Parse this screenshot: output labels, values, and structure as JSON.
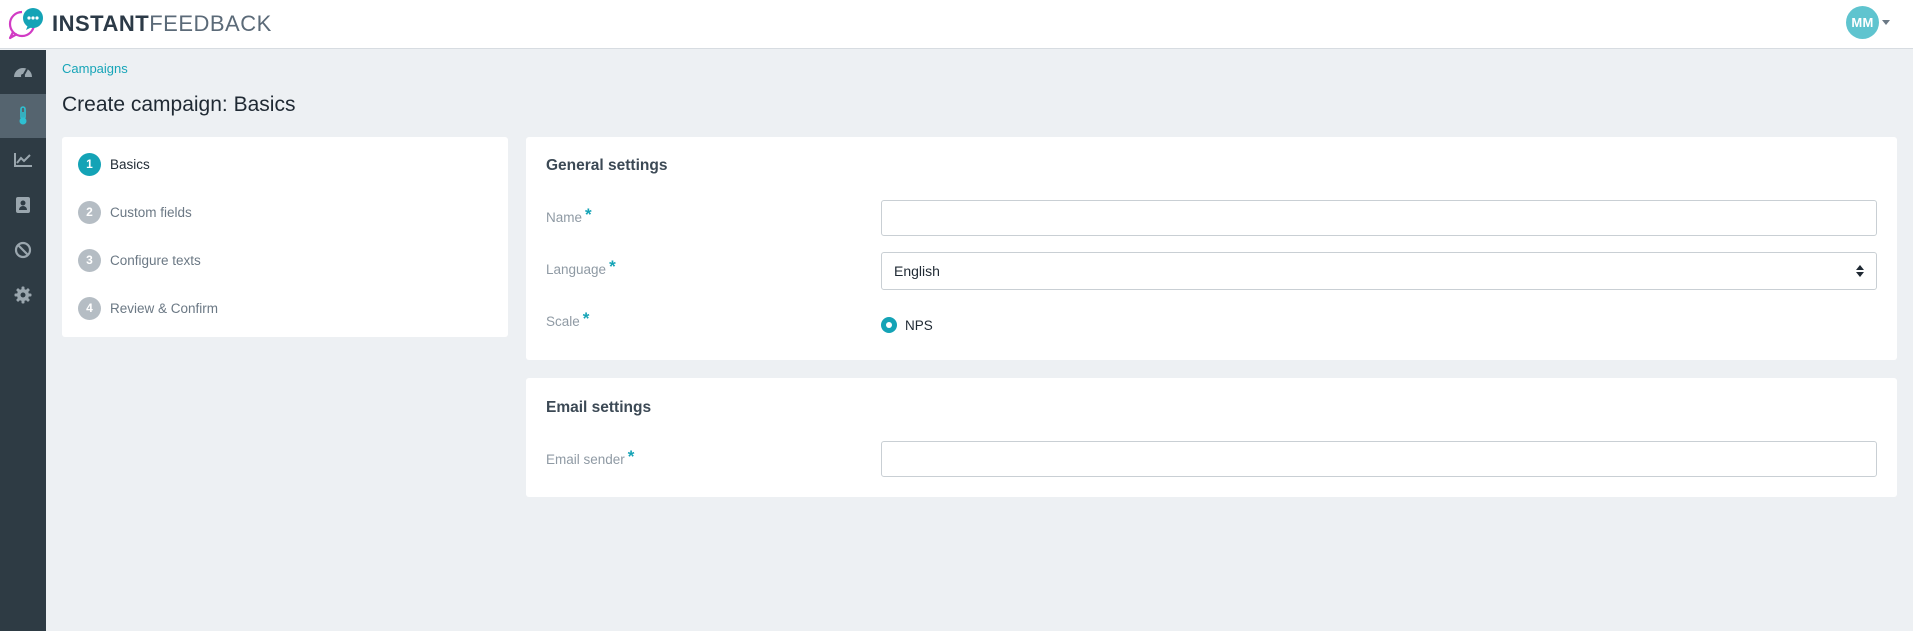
{
  "app": {
    "logo_bold": "INSTANT",
    "logo_light": "FEEDBACK",
    "brand_color": "#14a3b6",
    "user_initials": "MM"
  },
  "sidebar": {
    "items": [
      {
        "name": "dashboard",
        "icon": "speedometer-icon",
        "active": false
      },
      {
        "name": "campaigns",
        "icon": "thermometer-icon",
        "active": true
      },
      {
        "name": "reports",
        "icon": "line-chart-icon",
        "active": false
      },
      {
        "name": "contacts",
        "icon": "address-book-icon",
        "active": false
      },
      {
        "name": "blocked",
        "icon": "ban-icon",
        "active": false
      },
      {
        "name": "settings",
        "icon": "gear-icon",
        "active": false
      }
    ]
  },
  "breadcrumb": "Campaigns",
  "page_title": "Create campaign: Basics",
  "steps": [
    {
      "number": "1",
      "label": "Basics",
      "active": true
    },
    {
      "number": "2",
      "label": "Custom fields",
      "active": false
    },
    {
      "number": "3",
      "label": "Configure texts",
      "active": false
    },
    {
      "number": "4",
      "label": "Review & Confirm",
      "active": false
    }
  ],
  "general_settings": {
    "title": "General settings",
    "name_label": "Name",
    "name_value": "",
    "language_label": "Language",
    "language_value": "English",
    "scale_label": "Scale",
    "scale_option": "NPS",
    "required_mark": "*"
  },
  "email_settings": {
    "title": "Email settings",
    "sender_label": "Email sender",
    "sender_value": "",
    "required_mark": "*"
  }
}
